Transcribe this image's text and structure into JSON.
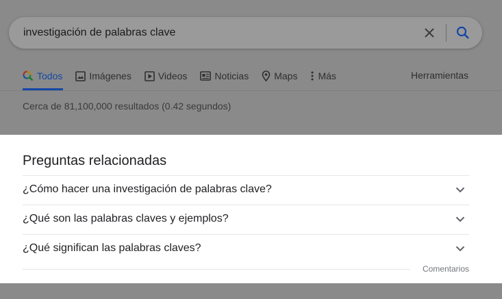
{
  "search": {
    "query": "investigación de palabras clave",
    "clear_icon": "close-icon",
    "search_icon": "search-icon"
  },
  "tabs": [
    {
      "label": "Todos",
      "icon": "search-multicolor-icon",
      "active": true
    },
    {
      "label": "Imágenes",
      "icon": "image-icon",
      "active": false
    },
    {
      "label": "Videos",
      "icon": "play-icon",
      "active": false
    },
    {
      "label": "Noticias",
      "icon": "news-icon",
      "active": false
    },
    {
      "label": "Maps",
      "icon": "location-pin-icon",
      "active": false
    },
    {
      "label": "Más",
      "icon": "more-vertical-icon",
      "active": false
    }
  ],
  "tools_label": "Herramientas",
  "result_stats": "Cerca de 81,100,000 resultados (0.42 segundos)",
  "related": {
    "title": "Preguntas relacionadas",
    "questions": [
      "¿Cómo hacer una investigación de palabras clave?",
      "¿Qué son las palabras claves y ejemplos?",
      "¿Qué significan las palabras claves?"
    ],
    "feedback": "Comentarios"
  },
  "colors": {
    "accent": "#1a73e8",
    "overlay": "#8a8a8a",
    "text": "#202124",
    "muted": "#70757a"
  }
}
